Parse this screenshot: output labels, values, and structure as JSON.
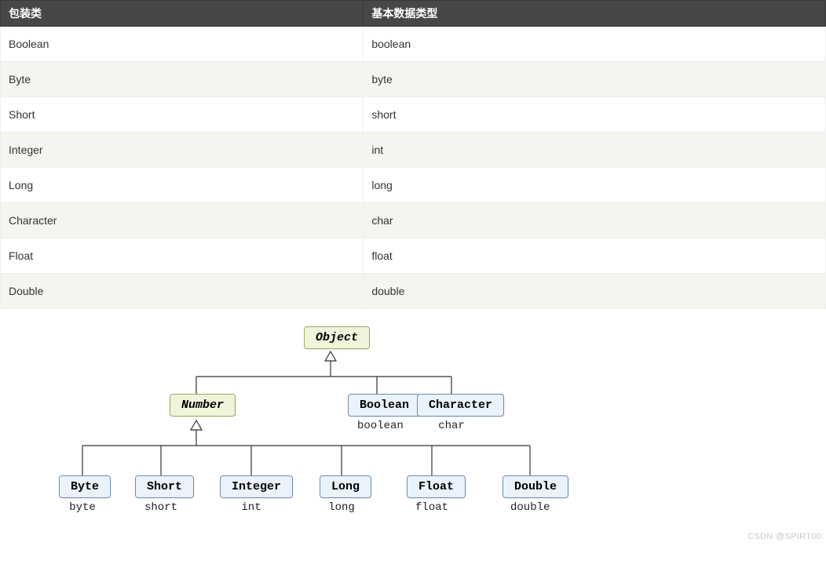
{
  "table": {
    "headers": [
      "包装类",
      "基本数据类型"
    ],
    "rows": [
      [
        "Boolean",
        "boolean"
      ],
      [
        "Byte",
        "byte"
      ],
      [
        "Short",
        "short"
      ],
      [
        "Integer",
        "int"
      ],
      [
        "Long",
        "long"
      ],
      [
        "Character",
        "char"
      ],
      [
        "Float",
        "float"
      ],
      [
        "Double",
        "double"
      ]
    ]
  },
  "diagram": {
    "root": {
      "label": "Object"
    },
    "number": {
      "label": "Number"
    },
    "boolean": {
      "label": "Boolean",
      "sub": "boolean"
    },
    "character": {
      "label": "Character",
      "sub": "char"
    },
    "byte": {
      "label": "Byte",
      "sub": "byte"
    },
    "short": {
      "label": "Short",
      "sub": "short"
    },
    "integer": {
      "label": "Integer",
      "sub": "int"
    },
    "long": {
      "label": "Long",
      "sub": "long"
    },
    "float": {
      "label": "Float",
      "sub": "float"
    },
    "double": {
      "label": "Double",
      "sub": "double"
    }
  },
  "watermark": "CSDN @SPIRT00"
}
